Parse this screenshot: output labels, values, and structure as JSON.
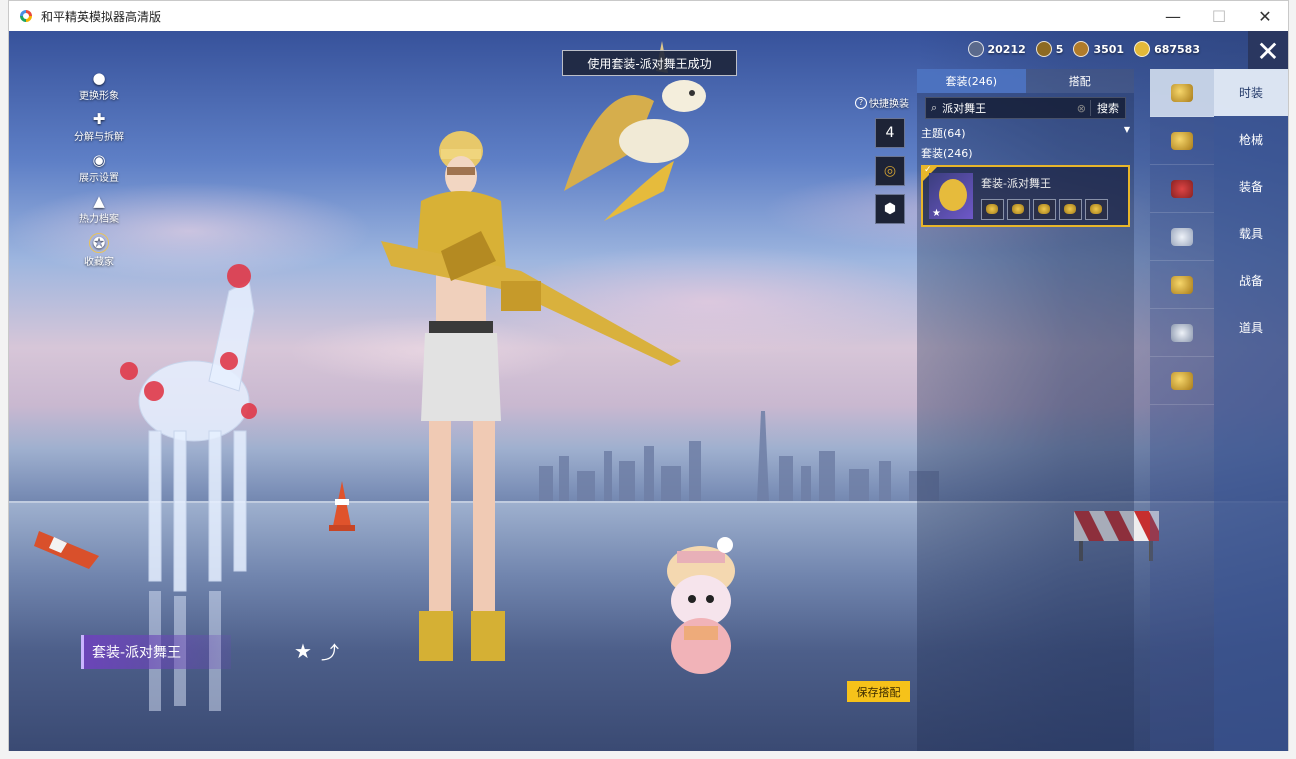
{
  "window": {
    "title": "和平精英模拟器高清版",
    "minimize": "—",
    "maximize": "☐",
    "close": "✕"
  },
  "currency": [
    {
      "icon": "coin-icon",
      "value": "20212"
    },
    {
      "icon": "token-icon",
      "value": "5"
    },
    {
      "icon": "medal-icon",
      "value": "3501"
    },
    {
      "icon": "gold-coin-icon",
      "value": "687583"
    }
  ],
  "toast": "使用套装-派对舞王成功",
  "left_menu": [
    {
      "icon": "avatar-icon",
      "label": "更换形象"
    },
    {
      "icon": "puzzle-icon",
      "label": "分解与拆解"
    },
    {
      "icon": "eye-icon",
      "label": "展示设置"
    },
    {
      "icon": "fire-icon",
      "label": "热力档案"
    },
    {
      "icon": "collection-icon",
      "label": "收藏家"
    }
  ],
  "quick_swap": {
    "label": "快捷换装",
    "slot_number": "4"
  },
  "outfit_name": "套装-派对舞王",
  "save_button": "保存搭配",
  "panel": {
    "tabs": [
      {
        "label": "套装(246)",
        "active": true
      },
      {
        "label": "搭配",
        "active": false
      }
    ],
    "search": {
      "value": "派对舞王",
      "button": "搜索"
    },
    "theme_filter": "主题(64)",
    "suit_count": "套装(246)",
    "card": {
      "title": "套装-派对舞王",
      "items": [
        "hat",
        "jacket",
        "pants",
        "shoes",
        "accessory"
      ]
    }
  },
  "categories": [
    {
      "label": "时装",
      "icon": "outfit-icon",
      "active": true
    },
    {
      "label": "枪械",
      "icon": "helmet-icon",
      "active": false
    },
    {
      "label": "装备",
      "icon": "gear-icon",
      "active": false
    },
    {
      "label": "载具",
      "icon": "mask-icon",
      "active": false
    },
    {
      "label": "战备",
      "icon": "supplies-icon",
      "active": false
    },
    {
      "label": "道具",
      "icon": "vehicle-icon",
      "active": false
    },
    {
      "label": "",
      "icon": "glove-icon",
      "active": false
    }
  ]
}
